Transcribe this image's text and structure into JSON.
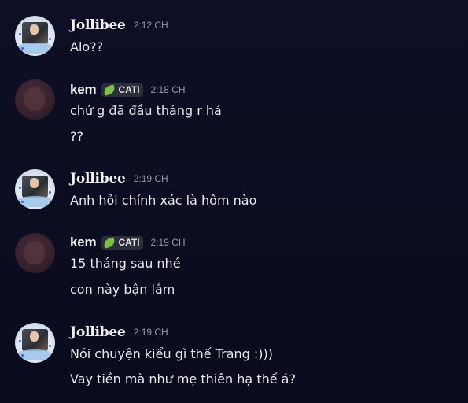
{
  "messages": [
    {
      "author": "Jollibee",
      "timestamp": "2:12 CH",
      "lines": [
        "Alo??"
      ]
    },
    {
      "author": "kem",
      "tag": {
        "icon": "leaf-icon",
        "label": "CATI"
      },
      "timestamp": "2:18 CH",
      "lines": [
        "chứ g đã đầu tháng r hả",
        "??"
      ]
    },
    {
      "author": "Jollibee",
      "timestamp": "2:19 CH",
      "lines": [
        "Anh hỏi chính xác là hôm nào"
      ]
    },
    {
      "author": "kem",
      "tag": {
        "icon": "leaf-icon",
        "label": "CATI"
      },
      "timestamp": "2:19 CH",
      "lines": [
        "15 tháng sau nhé",
        "con này bận lắm"
      ]
    },
    {
      "author": "Jollibee",
      "timestamp": "2:19 CH",
      "lines": [
        "Nói chuyện kiểu gì thế Trang :)))",
        "Vay tiền mà như mẹ thiên hạ thế á?"
      ]
    }
  ],
  "colors": {
    "background": "#0d0e22",
    "username": "#f2f3f5",
    "timestamp": "#949ba4",
    "message_text": "#e8e9ec",
    "tag_bg": "#2b2d38",
    "tag_leaf": "#7cc242"
  }
}
